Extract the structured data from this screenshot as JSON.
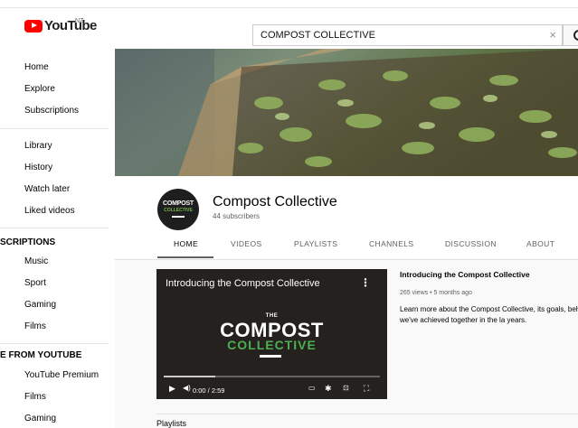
{
  "header": {
    "logo_text": "YouTube",
    "region": "NZ",
    "search_value": "COMPOST COLLECTIVE",
    "search_clear": "×"
  },
  "sidebar": {
    "main": [
      "Home",
      "Explore",
      "Subscriptions"
    ],
    "library": [
      "Library",
      "History",
      "Watch later",
      "Liked videos"
    ],
    "subscriptions_heading": "SCRIPTIONS",
    "subscriptions": [
      "Music",
      "Sport",
      "Gaming",
      "Films"
    ],
    "more_heading": "E FROM YOUTUBE",
    "more": [
      "YouTube Premium",
      "Films",
      "Gaming"
    ]
  },
  "channel": {
    "name": "Compost Collective",
    "subscribers": "44 subscribers",
    "avatar_line1": "COMPOST",
    "avatar_line2": "COLLECTIVE",
    "tabs": [
      "HOME",
      "VIDEOS",
      "PLAYLISTS",
      "CHANNELS",
      "DISCUSSION",
      "ABOUT"
    ],
    "active_tab": "HOME"
  },
  "featured_video": {
    "title": "Introducing the Compost Collective",
    "overlay_the": "THE",
    "overlay_compost": "COMPOST",
    "overlay_collective": "COLLECTIVE",
    "time": "0:00 / 2:59",
    "progress_fraction": 0.0,
    "buffered_fraction": 0.24,
    "views": "265 views • 5 months ago",
    "description": "Learn more about the Compost Collective, its goals, behind it and what we've achieved together in the la years."
  },
  "section_heading": "Playlists",
  "colors": {
    "brand_red": "#ff0000",
    "logo_green": "#4caf50"
  }
}
